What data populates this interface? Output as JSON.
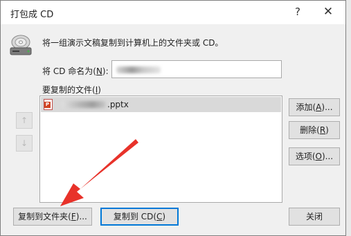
{
  "window": {
    "title": "打包成 CD",
    "help": "?",
    "close": "✕"
  },
  "description": "将一组演示文稿复制到计算机上的文件夹或 CD。",
  "name_field": {
    "label_prefix": "将 CD 命名为(",
    "label_key": "N",
    "label_suffix": "):",
    "value_blurred": true
  },
  "files_section": {
    "label_prefix": "要复制的文件(",
    "label_key": "I",
    "label_suffix": ")",
    "files": [
      {
        "name_visible": ".pptx",
        "icon": "powerpoint-file-icon"
      }
    ]
  },
  "side_buttons": {
    "add": {
      "prefix": "添加(",
      "key": "A",
      "suffix": ")..."
    },
    "remove": {
      "prefix": "删除(",
      "key": "R",
      "suffix": ")"
    },
    "options": {
      "prefix": "选项(",
      "key": "O",
      "suffix": ")..."
    }
  },
  "order_buttons": {
    "up": "↑",
    "down": "↓"
  },
  "bottom_buttons": {
    "copy_folder": {
      "prefix": "复制到文件夹(",
      "key": "F",
      "suffix": ")..."
    },
    "copy_cd": {
      "prefix": "复制到 CD(",
      "key": "C",
      "suffix": ")"
    },
    "close": "关闭"
  },
  "colors": {
    "dialog_bg": "#f0f0f0",
    "selection": "#d9d9d9",
    "default_border": "#0078d7",
    "annotation_arrow": "#e8322a"
  },
  "icons": [
    "cd-drive-icon",
    "powerpoint-file-icon",
    "arrow-up-icon",
    "arrow-down-icon",
    "red-pointer-arrow"
  ]
}
